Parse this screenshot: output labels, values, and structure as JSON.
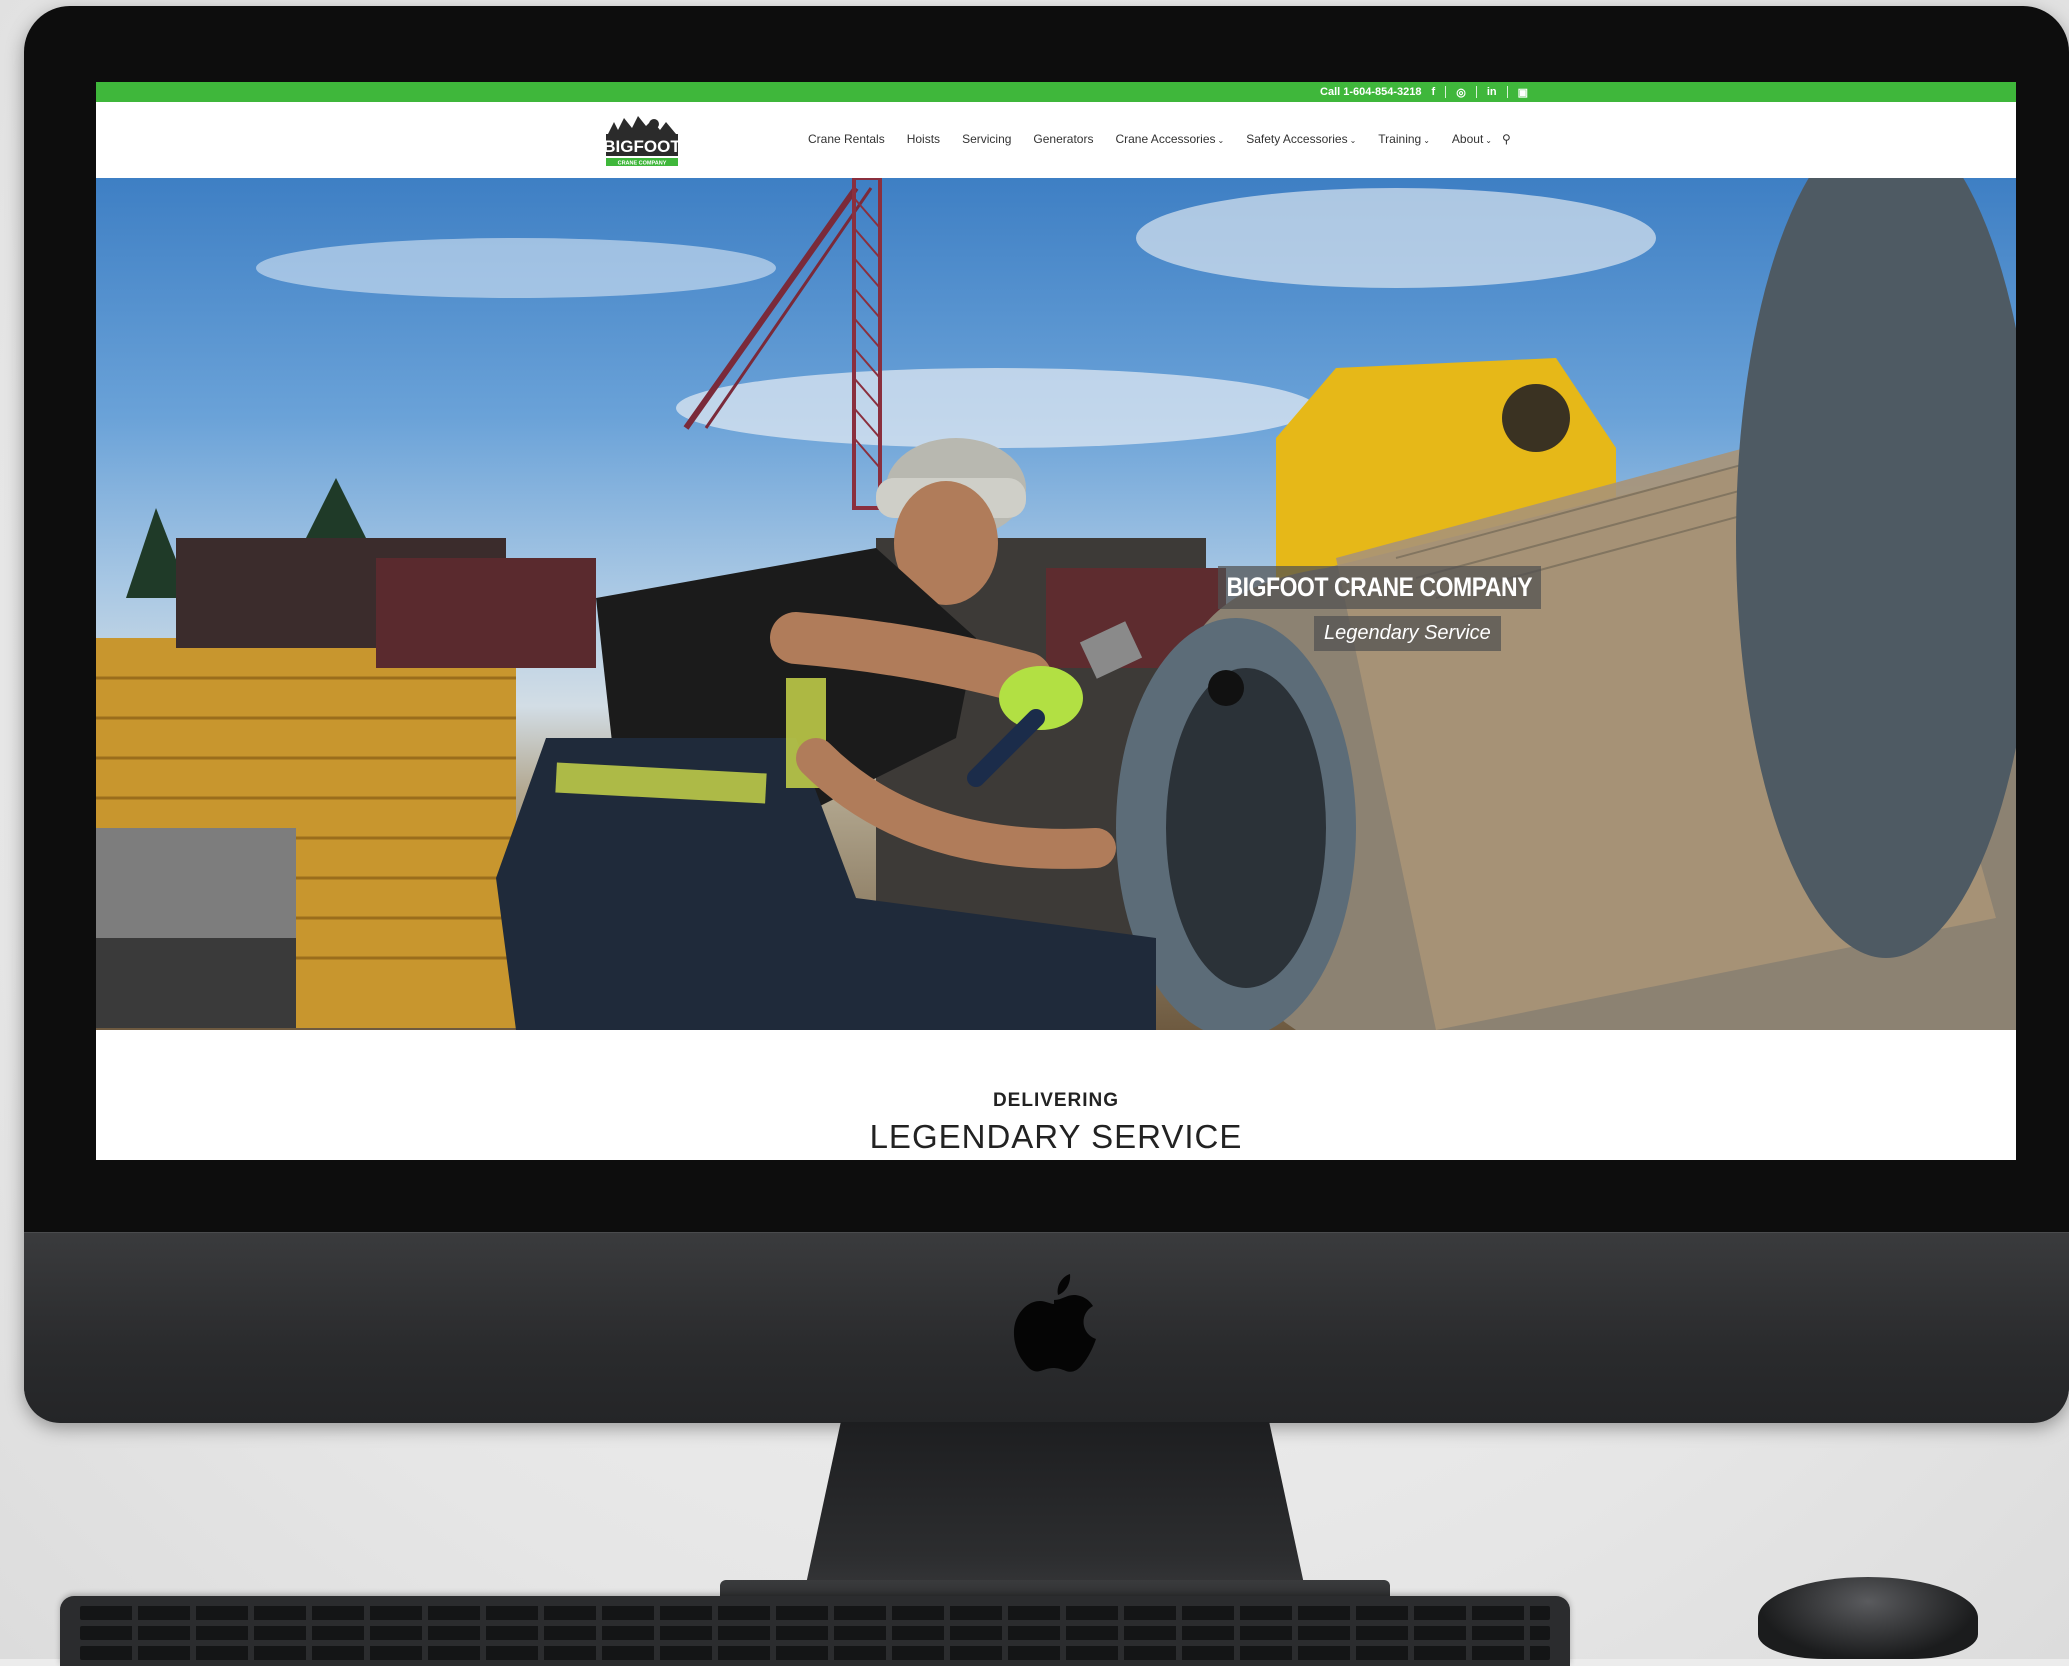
{
  "topbar": {
    "phone": "Call 1-604-854-3218",
    "social_icons": [
      "facebook-icon",
      "instagram-icon",
      "linkedin-icon",
      "youtube-icon"
    ],
    "color": "#3fb73b"
  },
  "header": {
    "logo_text": "BIGFOOT",
    "logo_subtext": "CRANE COMPANY",
    "nav": [
      {
        "label": "Crane Rentals",
        "dropdown": false
      },
      {
        "label": "Hoists",
        "dropdown": false
      },
      {
        "label": "Servicing",
        "dropdown": false
      },
      {
        "label": "Generators",
        "dropdown": false
      },
      {
        "label": "Crane Accessories",
        "dropdown": true
      },
      {
        "label": "Safety Accessories",
        "dropdown": true
      },
      {
        "label": "Training",
        "dropdown": true
      },
      {
        "label": "About",
        "dropdown": true
      }
    ],
    "search_icon": "search-icon"
  },
  "hero": {
    "title": "BIGFOOT CRANE COMPANY",
    "subtitle": "Legendary Service"
  },
  "intro": {
    "kicker": "DELIVERING",
    "heading": "LEGENDARY SERVICE"
  }
}
